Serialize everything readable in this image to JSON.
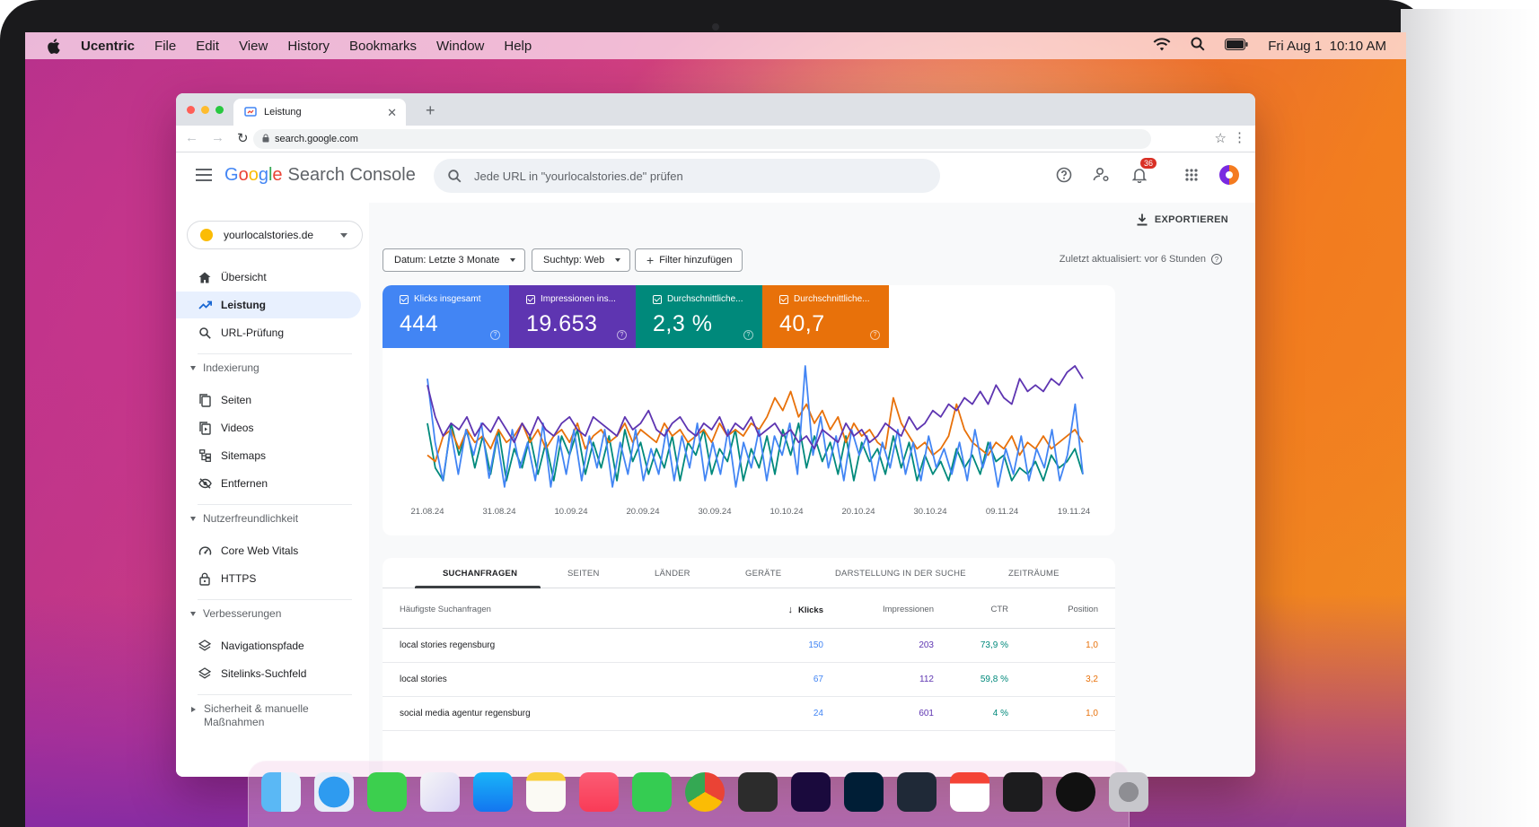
{
  "menubar": {
    "app": "Ucentric",
    "items": [
      "File",
      "Edit",
      "View",
      "History",
      "Bookmarks",
      "Window",
      "Help"
    ],
    "datetime": "Fri Aug 1  10:10 AM"
  },
  "browser": {
    "tab_title": "Leistung",
    "url": "search.google.com"
  },
  "gsc": {
    "logo": {
      "g1": "G",
      "g2": "o",
      "g3": "o",
      "g4": "g",
      "g5": "l",
      "g6": "e",
      "product": "Search Console"
    },
    "search_placeholder": "Jede URL in \"yourlocalstories.de\" prüfen",
    "notification_count": "36",
    "property": "yourlocalstories.de",
    "nav": {
      "overview": "Übersicht",
      "performance": "Leistung",
      "url_inspection": "URL-Prüfung",
      "indexing_header": "Indexierung",
      "pages": "Seiten",
      "videos": "Videos",
      "sitemaps": "Sitemaps",
      "removals": "Entfernen",
      "experience_header": "Nutzerfreundlichkeit",
      "core_web_vitals": "Core Web Vitals",
      "https": "HTTPS",
      "enhancements_header": "Verbesserungen",
      "breadcrumbs": "Navigationspfade",
      "sitelinks": "Sitelinks-Suchfeld",
      "security_header": "Sicherheit & manuelle Maßnahmen"
    },
    "export_label": "EXPORTIEREN",
    "filters": {
      "date": "Datum: Letzte 3 Monate",
      "search_type": "Suchtyp: Web",
      "add_filter": "Filter hinzufügen"
    },
    "last_updated": "Zuletzt aktualisiert: vor 6 Stunden",
    "metrics": [
      {
        "label": "Klicks insgesamt",
        "value": "444",
        "color": "#4285f4"
      },
      {
        "label": "Impressionen ins...",
        "value": "19.653",
        "color": "#5e35b1"
      },
      {
        "label": "Durchschnittliche...",
        "value": "2,3 %",
        "color": "#00897b"
      },
      {
        "label": "Durchschnittliche...",
        "value": "40,7",
        "color": "#e8710a"
      }
    ],
    "table": {
      "tabs": [
        "SUCHANFRAGEN",
        "SEITEN",
        "LÄNDER",
        "GERÄTE",
        "DARSTELLUNG IN DER SUCHE",
        "ZEITRÄUME"
      ],
      "headers": {
        "query": "Häufigste Suchanfragen",
        "clicks": "Klicks",
        "impressions": "Impressionen",
        "ctr": "CTR",
        "position": "Position"
      },
      "sort_arrow": "↓",
      "rows": [
        {
          "query": "local stories regensburg",
          "clicks": "150",
          "impressions": "203",
          "ctr": "73,9 %",
          "position": "1,0"
        },
        {
          "query": "local stories",
          "clicks": "67",
          "impressions": "112",
          "ctr": "59,8 %",
          "position": "3,2"
        },
        {
          "query": "social media agentur regensburg",
          "clicks": "24",
          "impressions": "601",
          "ctr": "4 %",
          "position": "1,0"
        }
      ]
    }
  },
  "chart_data": {
    "type": "line",
    "x_tick_labels": [
      "21.08.24",
      "31.08.24",
      "10.09.24",
      "20.09.24",
      "30.09.24",
      "10.10.24",
      "20.10.24",
      "30.10.24",
      "09.11.24",
      "19.11.24"
    ],
    "series": [
      {
        "name": "Klicks insgesamt",
        "color": "#4285f4",
        "values": [
          0.9,
          0.4,
          0.1,
          0.5,
          0.15,
          0.5,
          0.3,
          0.55,
          0.12,
          0.45,
          0.05,
          0.5,
          0.2,
          0.4,
          0.1,
          0.55,
          0.05,
          0.45,
          0.15,
          0.5,
          0.1,
          0.45,
          0.2,
          0.5,
          0.05,
          0.4,
          0.15,
          0.5,
          0.1,
          0.35,
          0.15,
          0.5,
          0.1,
          0.45,
          0.2,
          0.55,
          0.1,
          0.4,
          0.15,
          0.5,
          0.05,
          0.4,
          0.2,
          0.5,
          0.1,
          0.45,
          0.3,
          0.55,
          0.15,
          1.0,
          0.3,
          0.6,
          0.2,
          0.45,
          0.1,
          0.5,
          0.3,
          0.45,
          0.1,
          0.4,
          0.2,
          0.5,
          0.15,
          0.4,
          0.1,
          0.45,
          0.2,
          0.35,
          0.15,
          0.4,
          0.1,
          0.5,
          0.2,
          0.4,
          0.05,
          0.35,
          0.15,
          0.45,
          0.1,
          0.35,
          0.2,
          0.5,
          0.1,
          0.3,
          0.7,
          0.15
        ]
      },
      {
        "name": "Impressionen insgesamt",
        "color": "#5e35b1",
        "values": [
          0.85,
          0.6,
          0.45,
          0.55,
          0.5,
          0.6,
          0.45,
          0.55,
          0.48,
          0.6,
          0.5,
          0.4,
          0.55,
          0.45,
          0.6,
          0.5,
          0.45,
          0.55,
          0.6,
          0.5,
          0.45,
          0.6,
          0.55,
          0.5,
          0.45,
          0.6,
          0.5,
          0.55,
          0.65,
          0.5,
          0.45,
          0.55,
          0.6,
          0.5,
          0.45,
          0.55,
          0.5,
          0.6,
          0.45,
          0.55,
          0.5,
          0.6,
          0.45,
          0.5,
          0.55,
          0.45,
          0.5,
          0.4,
          0.45,
          0.35,
          0.5,
          0.45,
          0.4,
          0.55,
          0.45,
          0.5,
          0.4,
          0.45,
          0.55,
          0.5,
          0.45,
          0.6,
          0.5,
          0.55,
          0.65,
          0.6,
          0.7,
          0.65,
          0.75,
          0.7,
          0.8,
          0.7,
          0.85,
          0.75,
          0.7,
          0.9,
          0.8,
          0.85,
          0.8,
          0.9,
          0.85,
          0.95,
          1.0,
          0.9
        ]
      },
      {
        "name": "Durchschnittliche CTR",
        "color": "#00897b",
        "values": [
          0.55,
          0.2,
          0.1,
          0.55,
          0.3,
          0.5,
          0.2,
          0.45,
          0.15,
          0.5,
          0.1,
          0.35,
          0.2,
          0.45,
          0.15,
          0.4,
          0.1,
          0.45,
          0.3,
          0.5,
          0.15,
          0.4,
          0.2,
          0.45,
          0.1,
          0.5,
          0.25,
          0.4,
          0.15,
          0.35,
          0.2,
          0.45,
          0.1,
          0.4,
          0.3,
          0.5,
          0.15,
          0.35,
          0.25,
          0.5,
          0.1,
          0.35,
          0.2,
          0.45,
          0.15,
          0.5,
          0.3,
          0.55,
          0.2,
          0.45,
          0.25,
          0.4,
          0.15,
          0.45,
          0.1,
          0.4,
          0.25,
          0.35,
          0.15,
          0.45,
          0.2,
          0.4,
          0.1,
          0.3,
          0.15,
          0.25,
          0.1,
          0.35,
          0.2,
          0.3,
          0.15,
          0.4,
          0.25,
          0.3,
          0.1,
          0.2,
          0.15,
          0.25,
          0.1,
          0.3,
          0.2,
          0.25,
          0.35,
          0.15
        ]
      },
      {
        "name": "Durchschnittliche Position",
        "color": "#e8710a",
        "values": [
          0.3,
          0.25,
          0.45,
          0.5,
          0.35,
          0.5,
          0.4,
          0.45,
          0.35,
          0.5,
          0.4,
          0.45,
          0.55,
          0.4,
          0.5,
          0.35,
          0.45,
          0.5,
          0.4,
          0.55,
          0.35,
          0.45,
          0.5,
          0.4,
          0.45,
          0.55,
          0.4,
          0.5,
          0.45,
          0.4,
          0.55,
          0.45,
          0.5,
          0.4,
          0.45,
          0.5,
          0.4,
          0.55,
          0.45,
          0.5,
          0.45,
          0.55,
          0.5,
          0.6,
          0.75,
          0.65,
          0.8,
          0.6,
          0.7,
          0.55,
          0.65,
          0.5,
          0.6,
          0.4,
          0.55,
          0.45,
          0.5,
          0.4,
          0.35,
          0.75,
          0.55,
          0.45,
          0.35,
          0.4,
          0.3,
          0.35,
          0.45,
          0.7,
          0.5,
          0.4,
          0.35,
          0.3,
          0.4,
          0.35,
          0.45,
          0.3,
          0.4,
          0.35,
          0.45,
          0.35,
          0.4,
          0.45,
          0.5,
          0.4
        ]
      }
    ]
  }
}
